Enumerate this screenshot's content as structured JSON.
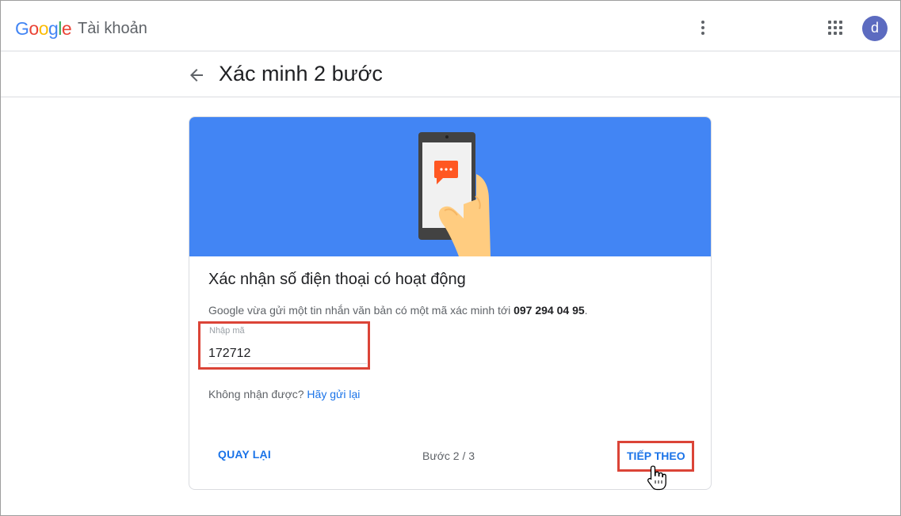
{
  "header": {
    "logo_letters": [
      "G",
      "o",
      "o",
      "g",
      "l",
      "e"
    ],
    "logo_colors": [
      "#4285f4",
      "#ea4335",
      "#fbbc05",
      "#4285f4",
      "#34a853",
      "#ea4335"
    ],
    "product_name": "Tài khoản",
    "avatar_letter": "d",
    "icons": [
      "more-vert-icon",
      "apps-grid-icon"
    ]
  },
  "subheader": {
    "title": "Xác minh 2 bước",
    "back_icon": "arrow-back-icon"
  },
  "card": {
    "hero_color": "#4285f4",
    "title": "Xác nhận số điện thoại có hoạt động",
    "description_prefix": "Google vừa gửi một tin nhắn văn bản có một mã xác minh tới ",
    "phone_number": "097 294 04 95",
    "description_suffix": ".",
    "code_field": {
      "label": "Nhập mã",
      "value": "172712"
    },
    "resend_prompt": "Không nhận được?",
    "resend_link": "Hãy gửi lại",
    "back_button": "QUAY LẠI",
    "step_indicator": "Bước 2 / 3",
    "next_button": "TIẾP THEO"
  },
  "colors": {
    "accent": "#1a73e8",
    "highlight": "#db4437",
    "avatar": "#5c6bc0"
  }
}
